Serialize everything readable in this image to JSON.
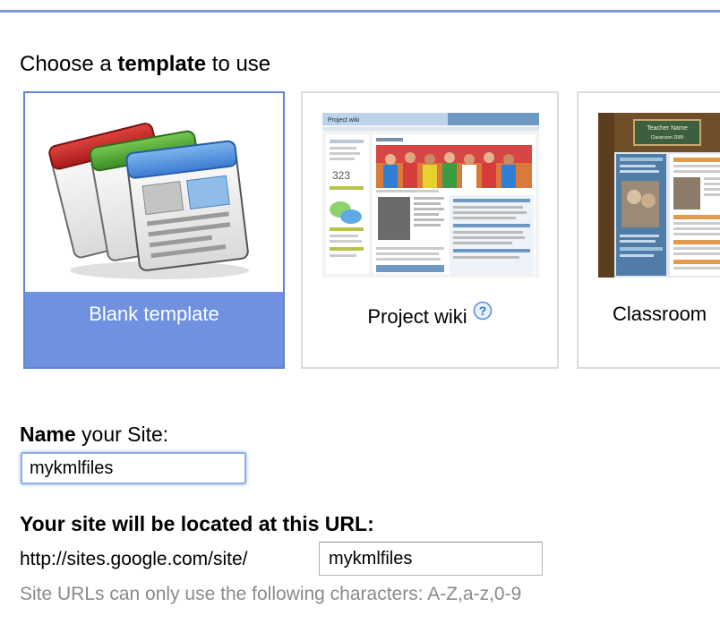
{
  "choose": {
    "prefix": "Choose a ",
    "emphasis": "template",
    "suffix": " to use"
  },
  "templates": [
    {
      "label": "Blank template",
      "selected": true
    },
    {
      "label": "Project wiki",
      "has_help": true
    },
    {
      "label": "Classroom"
    }
  ],
  "wiki_thumb": {
    "title": "Project wiki",
    "counter": "323"
  },
  "class_thumb": {
    "sign_line1": "Teacher Name",
    "sign_line2": "Classroom 2009"
  },
  "name_section": {
    "emphasis": "Name",
    "suffix": " your Site:",
    "value": "mykmlfiles"
  },
  "url_section": {
    "heading": "Your site will be located at this URL:",
    "prefix": "http://sites.google.com/site/",
    "value": "mykmlfiles",
    "help": "Site URLs can only use the following characters: A-Z,a-z,0-9"
  },
  "colors": {
    "accent": "#6f91e0",
    "top_rule": "#7d99d8",
    "help_text": "#8a8a8a"
  },
  "icons": [
    "blank-template-stack-icon",
    "help-icon"
  ]
}
